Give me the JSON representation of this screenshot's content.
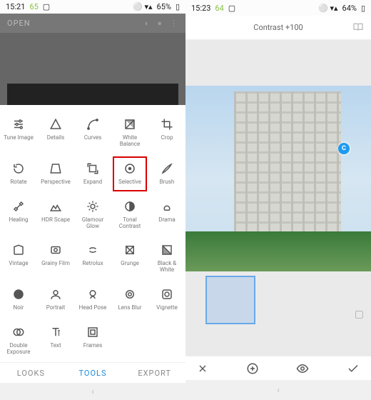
{
  "left": {
    "status": {
      "time": "15:21",
      "temp": "65",
      "battery": "65%"
    },
    "appbar": {
      "open": "OPEN"
    },
    "tools": [
      {
        "id": "tune",
        "label": "Tune Image"
      },
      {
        "id": "details",
        "label": "Details"
      },
      {
        "id": "curves",
        "label": "Curves"
      },
      {
        "id": "wb",
        "label": "White Balance"
      },
      {
        "id": "crop",
        "label": "Crop"
      },
      {
        "id": "rotate",
        "label": "Rotate"
      },
      {
        "id": "persp",
        "label": "Perspective"
      },
      {
        "id": "expand",
        "label": "Expand"
      },
      {
        "id": "selective",
        "label": "Selective",
        "highlighted": true
      },
      {
        "id": "brush",
        "label": "Brush"
      },
      {
        "id": "healing",
        "label": "Healing"
      },
      {
        "id": "hdr",
        "label": "HDR Scape"
      },
      {
        "id": "glow",
        "label": "Glamour Glow"
      },
      {
        "id": "tonal",
        "label": "Tonal Contrast"
      },
      {
        "id": "drama",
        "label": "Drama"
      },
      {
        "id": "vintage",
        "label": "Vintage"
      },
      {
        "id": "grainy",
        "label": "Grainy Film"
      },
      {
        "id": "retrolux",
        "label": "Retrolux"
      },
      {
        "id": "grunge",
        "label": "Grunge"
      },
      {
        "id": "bw",
        "label": "Black & White"
      },
      {
        "id": "noir",
        "label": "Noir"
      },
      {
        "id": "portrait",
        "label": "Portrait"
      },
      {
        "id": "headpose",
        "label": "Head Pose"
      },
      {
        "id": "lensblur",
        "label": "Lens Blur"
      },
      {
        "id": "vignette",
        "label": "Vignette"
      },
      {
        "id": "dblexp",
        "label": "Double Exposure"
      },
      {
        "id": "text",
        "label": "Text"
      },
      {
        "id": "frames",
        "label": "Frames"
      }
    ],
    "tabs": {
      "looks": "LOOKS",
      "tools": "TOOLS",
      "export": "EXPORT",
      "active": "tools"
    }
  },
  "right": {
    "status": {
      "time": "15:23",
      "temp": "64",
      "battery": "64%"
    },
    "header": {
      "label": "Contrast +100"
    },
    "marker": "C"
  }
}
